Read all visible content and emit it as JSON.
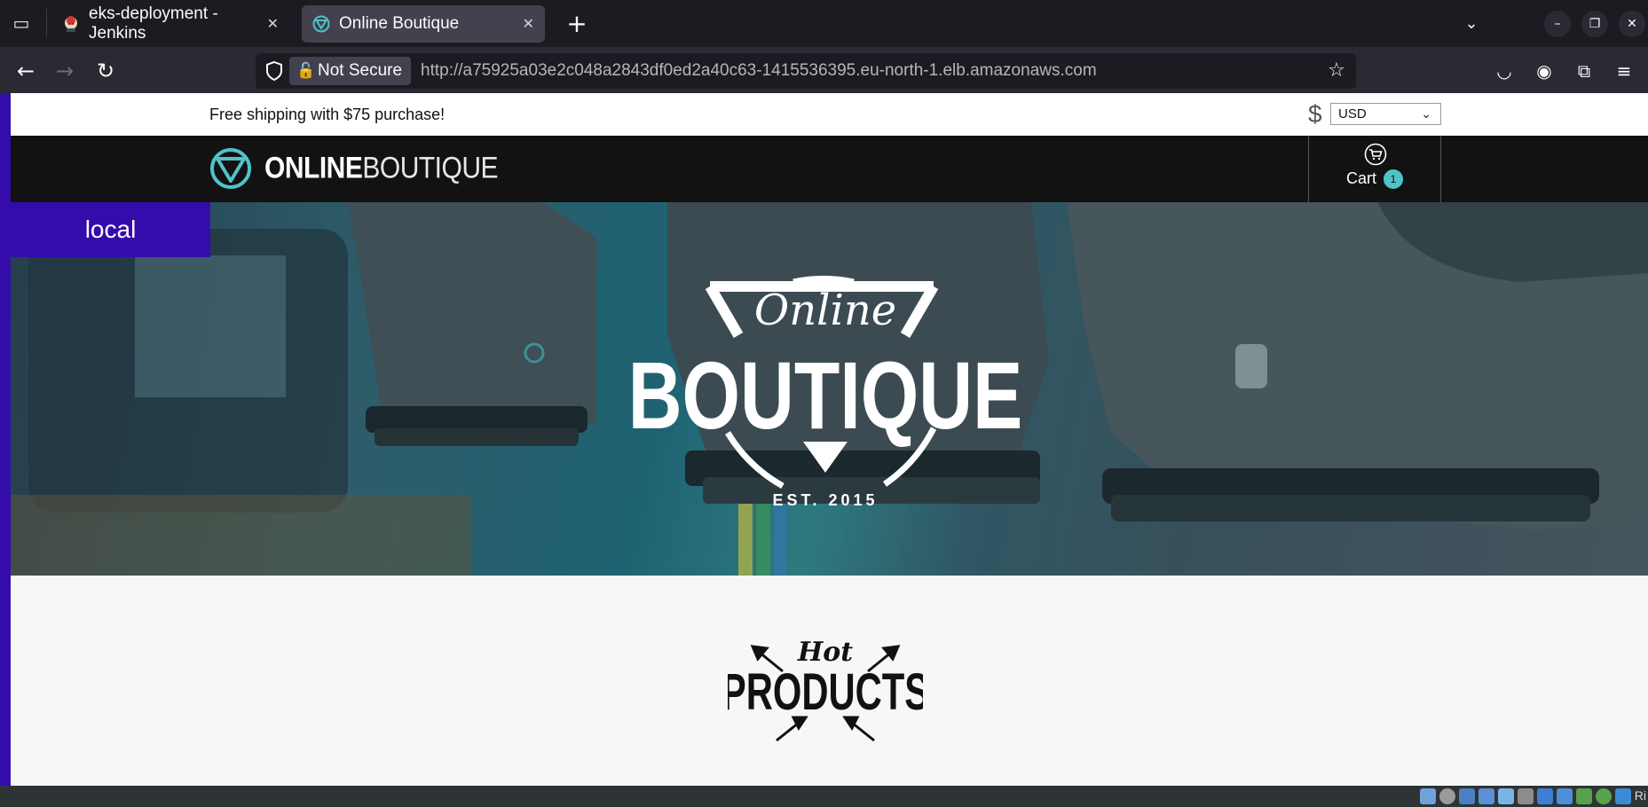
{
  "browser": {
    "tabs": [
      {
        "title": "eks-deployment - Jenkins",
        "active": false,
        "favicon": "jenkins-icon"
      },
      {
        "title": "Online Boutique",
        "active": true,
        "favicon": "boutique-icon"
      }
    ],
    "new_tab_icon": "+",
    "security_label": "Not Secure",
    "url": "http://a75925a03e2c048a2843df0ed2a40c63-1415536395.eu-north-1.elb.amazonaws.com"
  },
  "page": {
    "env_label": "local",
    "topbar": {
      "shipping_text": "Free shipping with $75 purchase!",
      "currency_symbol": "$",
      "currency_value": "USD"
    },
    "header": {
      "logo_bold": "ONLINE",
      "logo_light": "BOUTIQUE",
      "cart_label": "Cart",
      "cart_count": "1"
    },
    "hero": {
      "script_text": "Online",
      "brand_text": "BOUTIQUE",
      "est_text": "EST. 2015"
    },
    "section": {
      "hot_script": "Hot",
      "hot_title": "PRODUCTS"
    }
  },
  "taskbar": {
    "tray_text": "Ri"
  },
  "colors": {
    "accent_teal": "#4fc3c8",
    "env_purple": "#340cab",
    "header_black": "#121212"
  }
}
